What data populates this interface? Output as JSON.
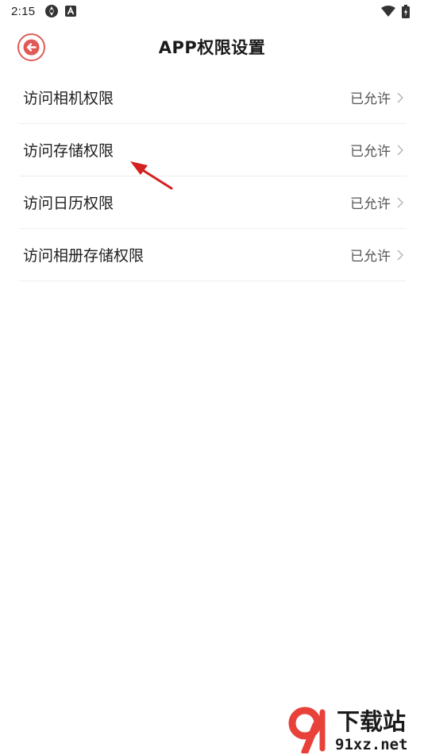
{
  "status_bar": {
    "time": "2:15",
    "icons": [
      "sync-icon",
      "a-badge-icon",
      "wifi-icon",
      "battery-icon"
    ]
  },
  "header": {
    "title": "APP权限设置",
    "back_icon": "back-arrow-icon",
    "accent_color": "#e05b57"
  },
  "permissions": {
    "items": [
      {
        "label": "访问相机权限",
        "status": "已允许"
      },
      {
        "label": "访问存储权限",
        "status": "已允许"
      },
      {
        "label": "访问日历权限",
        "status": "已允许"
      },
      {
        "label": "访问相册存储权限",
        "status": "已允许"
      }
    ]
  },
  "annotation": {
    "icon": "red-pointer-arrow-icon",
    "color": "#d42020"
  },
  "watermark": {
    "line1": "下载站",
    "line2": "91xz.net",
    "logo_color": "#e8413a"
  }
}
